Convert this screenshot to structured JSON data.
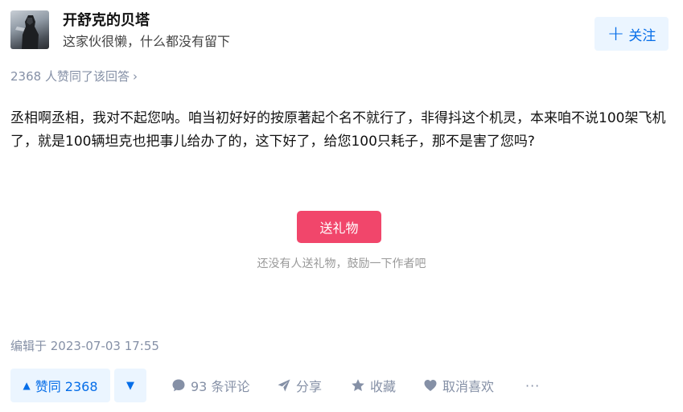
{
  "author": {
    "name": "开舒克的贝塔",
    "bio": "这家伙很懒，什么都没有留下",
    "follow_label": "关注"
  },
  "voters": {
    "text": "2368 人赞同了该回答",
    "chevron": "›"
  },
  "answer": {
    "content": "丞相啊丞相，我对不起您呐。咱当初好好的按原著起个名不就行了，非得抖这个机灵，本来咱不说100架飞机了，就是100辆坦克也把事儿给办了的，这下好了，给您100只耗子，那不是害了您吗?"
  },
  "gift": {
    "button_label": "送礼物",
    "hint": "还没有人送礼物，鼓励一下作者吧"
  },
  "edited": "编辑于 2023-07-03 17:55",
  "actions": {
    "vote_up": "赞同 2368",
    "vote_up_icon": "▲",
    "vote_down_icon": "▼",
    "comment": "93 条评论",
    "share": "分享",
    "collect": "收藏",
    "like": "取消喜欢",
    "more": "···"
  },
  "colors": {
    "accent": "#056de8",
    "accent_bg": "#ebf5ff",
    "gift": "#f1466b",
    "muted": "#8590a6"
  }
}
